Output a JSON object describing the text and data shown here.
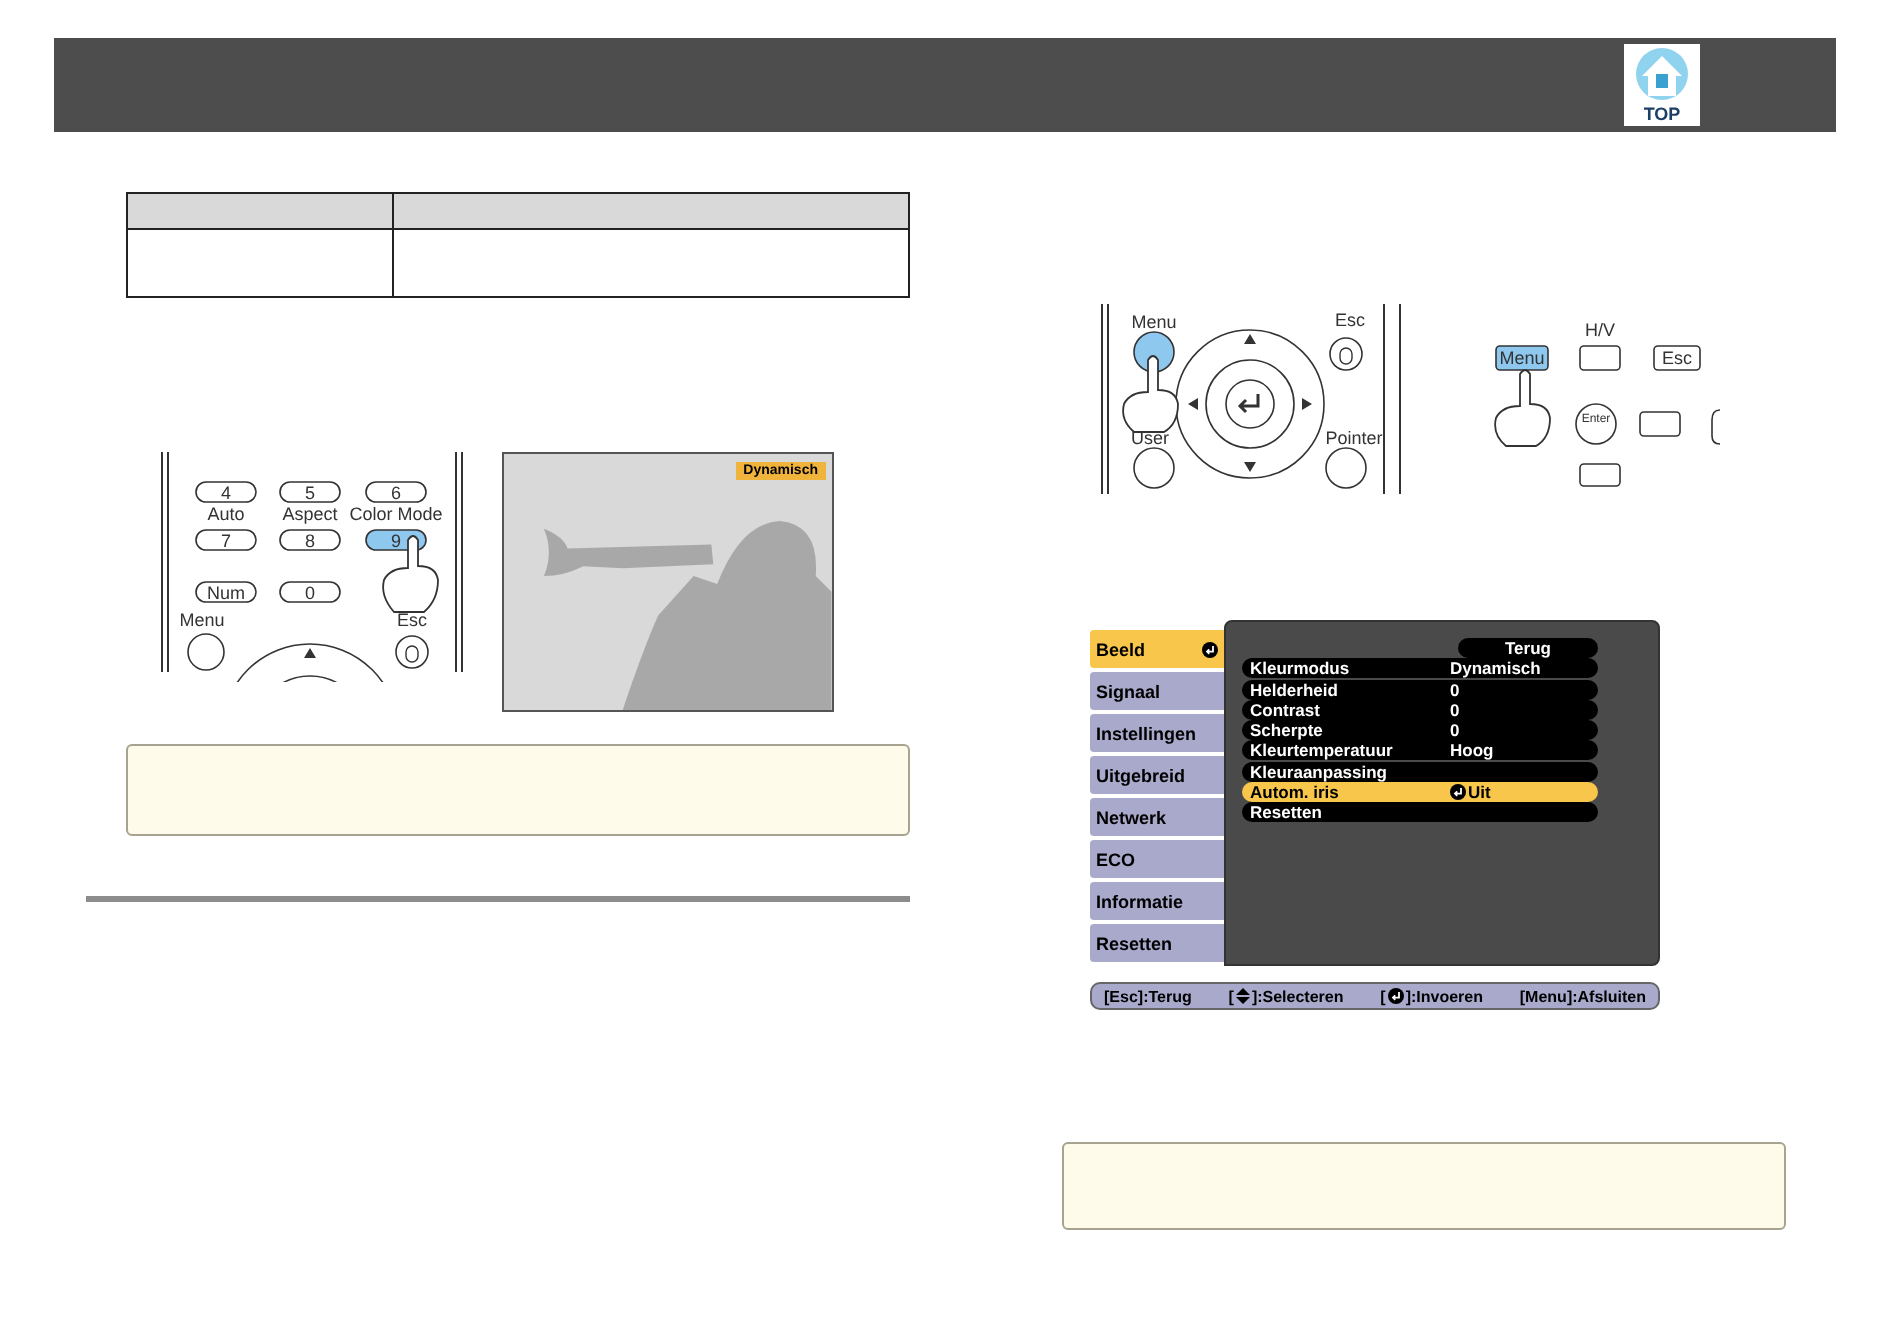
{
  "header": {
    "top_button": "TOP"
  },
  "color_mode_remote": {
    "keys": [
      {
        "label": "4",
        "selected": false
      },
      {
        "label": "5",
        "selected": false
      },
      {
        "label": "6",
        "selected": false
      },
      {
        "label": "7",
        "selected": false
      },
      {
        "label": "8",
        "selected": false
      },
      {
        "label": "9",
        "selected": true
      },
      {
        "label": "Num",
        "selected": false
      },
      {
        "label": "0",
        "selected": false
      }
    ],
    "captions": [
      "Auto",
      "Aspect",
      "Color Mode",
      "Menu",
      "Esc"
    ]
  },
  "projected_image": {
    "mode_badge": "Dynamisch"
  },
  "menu_remote": {
    "captions": [
      "Menu",
      "Esc",
      "User",
      "Pointer"
    ],
    "menu_pressed": true
  },
  "control_panel": {
    "caption": "H/V",
    "keys": [
      {
        "label": "Menu",
        "pressed": true
      },
      {
        "label": "Esc",
        "pressed": false
      },
      {
        "label": "Enter",
        "pressed": false
      }
    ]
  },
  "osd_menu": {
    "tabs": [
      {
        "label": "Beeld",
        "selected": true
      },
      {
        "label": "Signaal",
        "selected": false
      },
      {
        "label": "Instellingen",
        "selected": false
      },
      {
        "label": "Uitgebreid",
        "selected": false
      },
      {
        "label": "Netwerk",
        "selected": false
      },
      {
        "label": "ECO",
        "selected": false
      },
      {
        "label": "Informatie",
        "selected": false
      },
      {
        "label": "Resetten",
        "selected": false
      }
    ],
    "back_button": "Terug",
    "items": [
      {
        "name": "Kleurmodus",
        "value": "Dynamisch",
        "kind": "value",
        "selected": false
      },
      {
        "name": "Helderheid",
        "value": "0",
        "kind": "value",
        "selected": false
      },
      {
        "name": "Contrast",
        "value": "0",
        "kind": "value",
        "selected": false
      },
      {
        "name": "Scherpte",
        "value": "0",
        "kind": "value",
        "selected": false
      },
      {
        "name": "Kleurtemperatuur",
        "value": "Hoog",
        "kind": "value",
        "selected": false
      },
      {
        "name": "Kleuraanpassing",
        "kind": "submenu",
        "selected": false
      },
      {
        "name": "Autom. iris",
        "value": "Uit",
        "kind": "choice",
        "selected": true
      },
      {
        "name": "Resetten",
        "kind": "submenu",
        "selected": false
      }
    ],
    "footer": [
      {
        "kind": "text",
        "text": "[Esc]:Terug"
      },
      {
        "kind": "updown",
        "before": "[",
        "after": "]:Selecteren"
      },
      {
        "kind": "enter",
        "before": "[",
        "after": "]:Invoeren"
      },
      {
        "kind": "text",
        "text": "[Menu]:Afsluiten"
      }
    ]
  }
}
